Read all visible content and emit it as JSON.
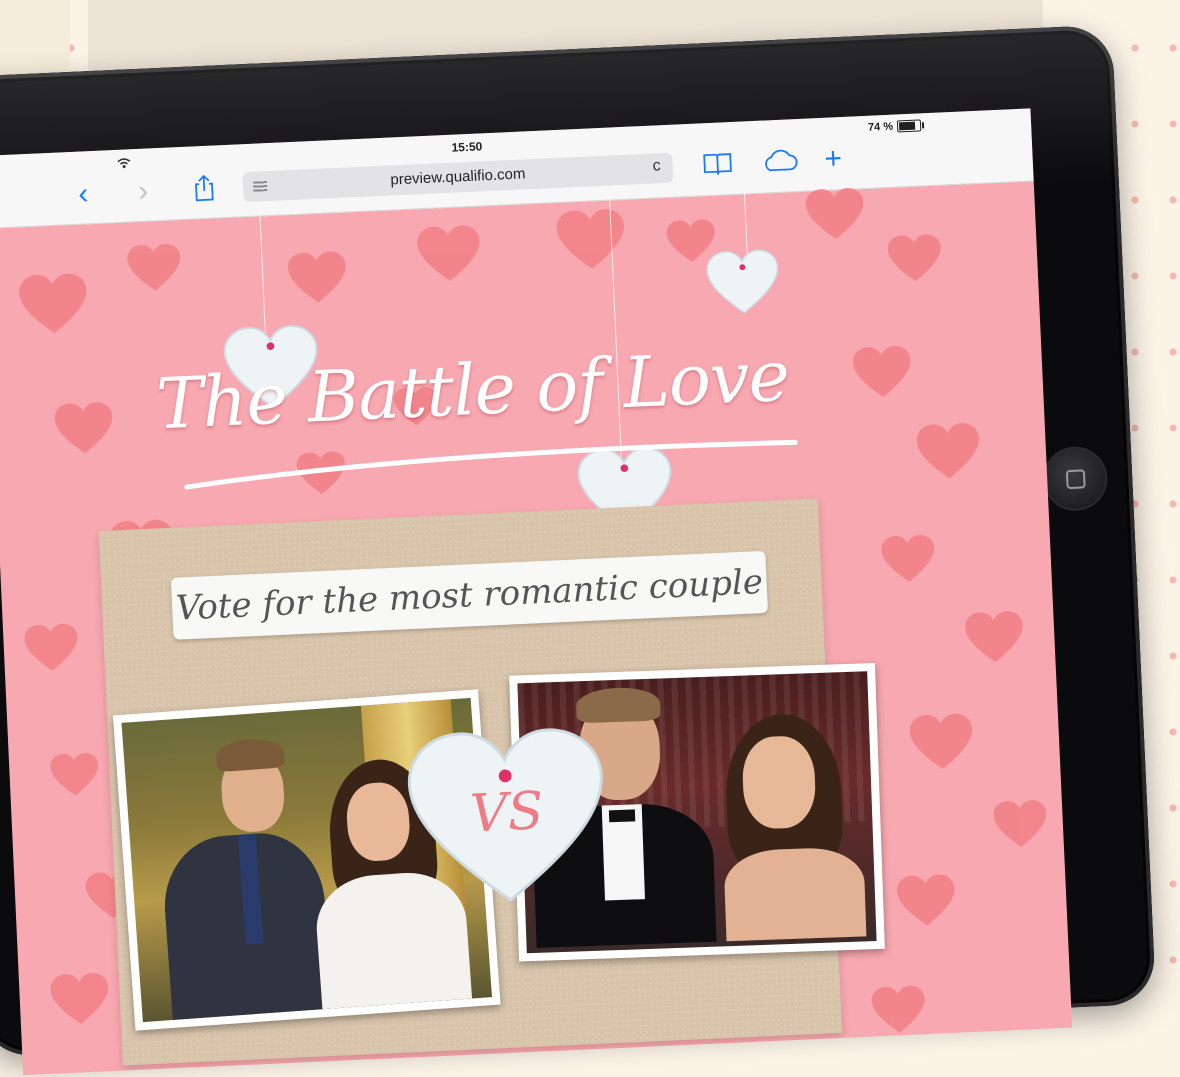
{
  "browser": {
    "time": "15:50",
    "battery": "74 %",
    "url": "preview.qualifio.com",
    "back_glyph": "‹",
    "forward_glyph": "›",
    "plus_glyph": "+",
    "reload_glyph": "c"
  },
  "campaign": {
    "title": "The Battle of Love",
    "subtitle": "Vote for the most romantic couple",
    "versus": "VS"
  },
  "icons": [
    "wifi-icon",
    "back-icon",
    "forward-icon",
    "share-icon",
    "reader-icon",
    "reload-icon",
    "bookmarks-icon",
    "cloud-icon",
    "plus-icon",
    "home-button-icon",
    "heart-icon"
  ],
  "colors": {
    "accent": "#1a7cf5",
    "page_pink": "#f7a8b0",
    "heart_red": "#f27f86",
    "pin_magenta": "#e0306a"
  }
}
